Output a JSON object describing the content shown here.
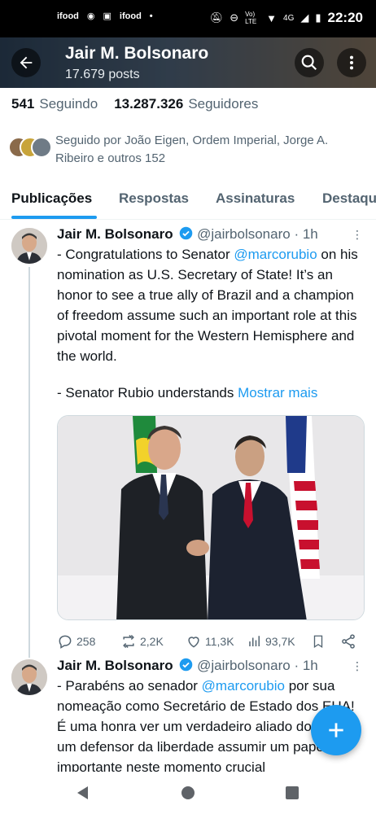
{
  "status_bar": {
    "time": "22:20",
    "left_badges": [
      "ifood",
      "ifood"
    ],
    "network": "4G",
    "volte": "Vo) LTE"
  },
  "header": {
    "title": "Jair M. Bolsonaro",
    "posts": "17.679 posts"
  },
  "stats": {
    "following_count": "541",
    "following_label": "Seguindo",
    "followers_count": "13.287.326",
    "followers_label": "Seguidores"
  },
  "followed_by": "Seguido por João Eigen, Ordem Imperial, Jorge A. Ribeiro e outros 152",
  "tabs": [
    {
      "label": "Publicações"
    },
    {
      "label": "Respostas"
    },
    {
      "label": "Assinaturas"
    },
    {
      "label": "Destaqu"
    }
  ],
  "posts": [
    {
      "name": "Jair M. Bolsonaro",
      "handle": "@jairbolsonaro",
      "time": "· 1h",
      "text_p1_a": "- Congratulations to Senator ",
      "mention": "@marcorubio",
      "text_p1_b": " on his nomination as U.S. Secretary of State! It’s an honor to see a true ally of Brazil and a champion of freedom assume such an important role at this pivotal moment for the Western Hemisphere and the world.",
      "text_p2": "- Senator Rubio understands ",
      "show_more": "Mostrar mais",
      "replies": "258",
      "reposts": "2,2K",
      "likes": "11,3K",
      "views": "93,7K"
    },
    {
      "name": "Jair M. Bolsonaro",
      "handle": "@jairbolsonaro",
      "time": "· 1h",
      "text_a": "- Parabéns ao senador ",
      "mention": "@marcorubio",
      "text_b": " por sua nomeação como Secretário de Estado dos EUA! É uma honra ver um verdadeiro aliado do Brasil e um defensor da liberdade assumir um papel tão importante neste momento crucial"
    }
  ],
  "colors": {
    "accent": "#1d9bf0",
    "text_primary": "#0f1419",
    "text_secondary": "#536471"
  }
}
